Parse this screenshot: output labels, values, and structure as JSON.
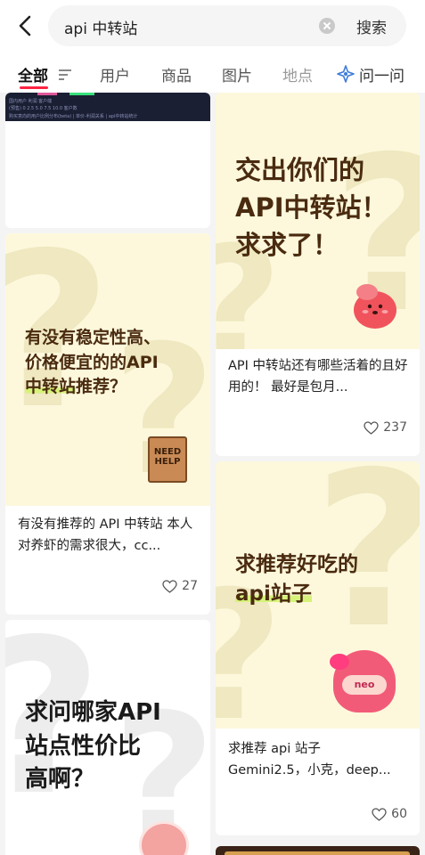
{
  "search": {
    "query": "api 中转站",
    "button_label": "搜索"
  },
  "tabs": [
    {
      "label": "全部"
    },
    {
      "label": "用户"
    },
    {
      "label": "商品"
    },
    {
      "label": "图片"
    },
    {
      "label": "地点"
    },
    {
      "label": "问一问"
    }
  ],
  "screenshot_strip": {
    "row1": "国内用户  利润  客户端",
    "row2": "(预售)  0    2.5   5.0   7.5   10.0   客户数",
    "row3": "购买意向的用户比例分布(beta) | 单价-利润关系 | api中转站统计"
  },
  "cards": [
    {
      "cover_title_line1": "交出你们的",
      "cover_title_line2": "API中转站！",
      "cover_title_line3": "求求了！",
      "text": "API 中转站还有哪些活着的且好用的！ 最好是包月...",
      "likes": "237"
    },
    {
      "cover_title_line1": "有没有稳定性高、",
      "cover_title_line2": "价格便宜的的API",
      "cover_title_line3a": "中转站",
      "cover_title_line3b": "推荐？",
      "sign_text": "NEED HELP",
      "text": "有没有推荐的 API 中转站 本人对养虾的需求很大，cc...",
      "likes": "27"
    },
    {
      "cover_title_line1": "求推荐好吃的",
      "cover_title_line2": "api站子",
      "mascot_text": "neo",
      "text_line1": "求推荐 api 站子",
      "text_line2": "Gemini2.5，小克，deep...",
      "likes": "60"
    },
    {
      "cover_title_line1": "求问哪家API",
      "cover_title_line2": "站点性价比",
      "cover_title_line3": "高啊？"
    }
  ]
}
